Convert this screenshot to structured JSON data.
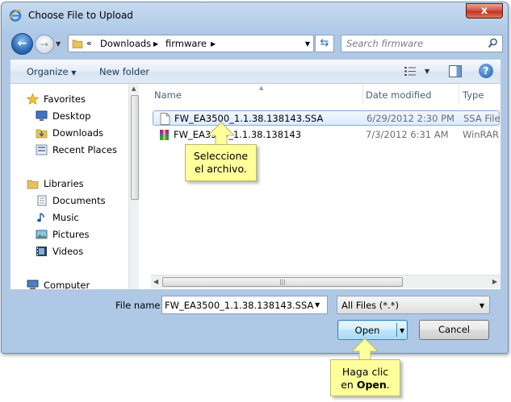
{
  "window": {
    "title": "Choose File to Upload",
    "close_label": "x"
  },
  "address": {
    "overflow": "«",
    "crumbs": [
      "Downloads",
      "firmware"
    ],
    "search_placeholder": "Search firmware"
  },
  "toolbar": {
    "organize": "Organize",
    "organize_arrow": "▼",
    "new_folder": "New folder",
    "view_arrow": "▼",
    "help": "?"
  },
  "nav": {
    "items": [
      {
        "label": "Favorites",
        "icon": "star-icon"
      },
      {
        "label": "Desktop",
        "icon": "desktop-icon"
      },
      {
        "label": "Downloads",
        "icon": "downloads-icon"
      },
      {
        "label": "Recent Places",
        "icon": "recent-places-icon"
      },
      {
        "label": "Libraries",
        "icon": "libraries-icon"
      },
      {
        "label": "Documents",
        "icon": "documents-icon"
      },
      {
        "label": "Music",
        "icon": "music-icon"
      },
      {
        "label": "Pictures",
        "icon": "pictures-icon"
      },
      {
        "label": "Videos",
        "icon": "videos-icon"
      },
      {
        "label": "Computer",
        "icon": "computer-icon"
      }
    ]
  },
  "columns": {
    "name": "Name",
    "date": "Date modified",
    "type": "Type"
  },
  "files": [
    {
      "name": "FW_EA3500_1.1.38.138143.SSA",
      "date": "6/29/2012 2:30 PM",
      "type": "SSA File"
    },
    {
      "name": "FW_EA3500_1.1.38.138143",
      "date": "7/3/2012 6:31 AM",
      "type": "WinRAR ZIP"
    }
  ],
  "bottom": {
    "file_name_label": "File name:",
    "file_name_value": "FW_EA3500_1.1.38.138143.SSA",
    "filter": "All Files (*.*)",
    "open": "Open",
    "cancel": "Cancel"
  },
  "callouts": {
    "select_line1": "Seleccione",
    "select_line2": "el archivo.",
    "open_line1": "Haga clic",
    "open_line2_prefix": "en ",
    "open_line2_bold": "Open",
    "open_line2_suffix": "."
  },
  "colors": {
    "callout_bg": "#ffff9c",
    "selection_border": "#84acdd",
    "window_frame": "#aec8e6"
  }
}
